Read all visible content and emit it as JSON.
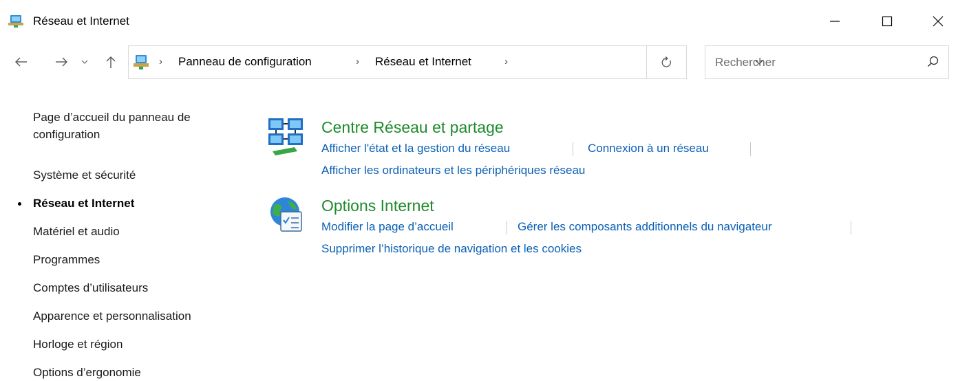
{
  "window": {
    "title": "Réseau et Internet",
    "controls": {
      "minimize": "minimize-icon",
      "maximize": "maximize-icon",
      "close": "close-icon"
    }
  },
  "nav": {
    "back": "arrow-left-icon",
    "forward": "arrow-right-icon",
    "recent": "chevron-down-icon",
    "up": "arrow-up-icon",
    "breadcrumbs": [
      "Panneau de configuration",
      "Réseau et Internet"
    ],
    "refresh": "refresh-icon",
    "search_placeholder": "Rechercher"
  },
  "sidebar": {
    "items": [
      {
        "label": "Page d’accueil du panneau de",
        "label2": "configuration"
      },
      {
        "label": "Système et sécurité"
      },
      {
        "label": "Réseau et Internet",
        "current": true
      },
      {
        "label": "Matériel et audio"
      },
      {
        "label": "Programmes"
      },
      {
        "label": "Comptes d’utilisateurs"
      },
      {
        "label": "Apparence et personnalisation"
      },
      {
        "label": "Horloge et région"
      },
      {
        "label": "Options d’ergonomie"
      }
    ]
  },
  "sections": [
    {
      "title": "Centre Réseau et partage",
      "icon": "network-sharing-icon",
      "links": [
        "Afficher l'état et la gestion du réseau",
        "Connexion à un réseau",
        "Afficher les ordinateurs et les périphériques réseau"
      ]
    },
    {
      "title": "Options Internet",
      "icon": "internet-options-icon",
      "links": [
        "Modifier la page d’accueil",
        "Gérer les composants additionnels du navigateur",
        "Supprimer l’historique de navigation et les cookies"
      ]
    }
  ],
  "colors": {
    "link": "#0a5fb4",
    "section_title": "#1e8b2d"
  }
}
